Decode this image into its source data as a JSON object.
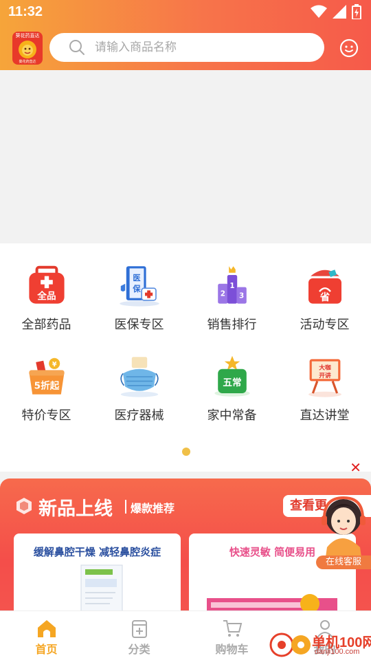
{
  "status_bar": {
    "time": "11:32"
  },
  "header": {
    "logo_title": "葵花药直达",
    "logo_subtitle": "葵花药直达",
    "search_placeholder": "请输入商品名称"
  },
  "categories": [
    {
      "label": "全部药品",
      "icon": "medicine-box-icon"
    },
    {
      "label": "医保专区",
      "icon": "medical-insurance-icon"
    },
    {
      "label": "销售排行",
      "icon": "ranking-podium-icon"
    },
    {
      "label": "活动专区",
      "icon": "promotion-gift-icon"
    },
    {
      "label": "特价专区",
      "icon": "discount-basket-icon"
    },
    {
      "label": "医疗器械",
      "icon": "face-mask-icon"
    },
    {
      "label": "家中常备",
      "icon": "home-essentials-icon"
    },
    {
      "label": "直达讲堂",
      "icon": "lecture-hall-icon"
    }
  ],
  "grid_icon_text": {
    "all": "全品",
    "yibao": "医保",
    "rank": "213",
    "sheng": "省",
    "discount": "5折起",
    "changbei": "五常",
    "lecture": "大咖开讲"
  },
  "promo": {
    "title": "新品上线",
    "subtitle": "爆款推荐",
    "more_button": "查看更",
    "cards": [
      {
        "text": "缓解鼻腔干燥 减轻鼻腔炎症"
      },
      {
        "text": "快速灵敏 简便易用"
      }
    ],
    "agent_label": "在线客服"
  },
  "bottom_nav": [
    {
      "label": "首页",
      "icon": "home-icon",
      "active": true
    },
    {
      "label": "分类",
      "icon": "category-icon",
      "active": false
    },
    {
      "label": "购物车",
      "icon": "cart-icon",
      "active": false
    },
    {
      "label": "我的",
      "icon": "user-icon",
      "active": false
    }
  ],
  "watermark": {
    "text": "单机100网",
    "url": "danji100.com"
  },
  "colors": {
    "accent": "#f5a623",
    "header_start": "#f6a53a",
    "header_end": "#f65a4a",
    "promo": "#f44e4a"
  }
}
